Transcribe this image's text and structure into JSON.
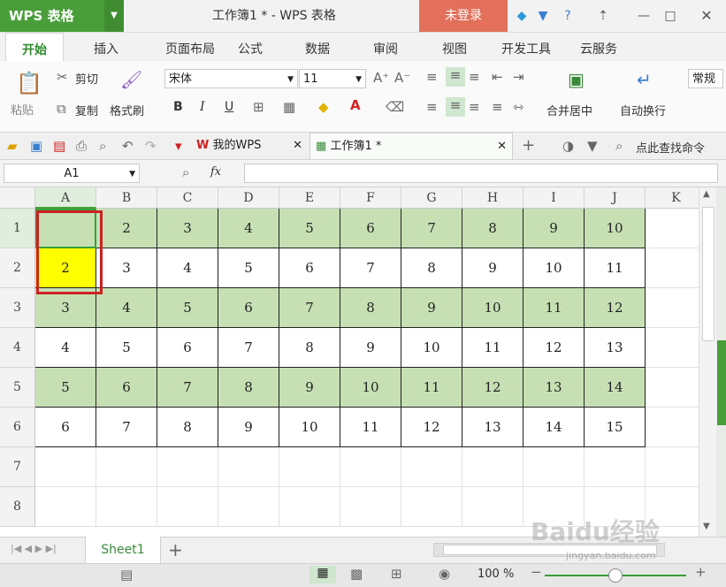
{
  "titlebar": {
    "app_name": "WPS 表格",
    "doc_title": "工作簿1 * - WPS 表格",
    "login": "未登录"
  },
  "menu": [
    "开始",
    "插入",
    "页面布局",
    "公式",
    "数据",
    "审阅",
    "视图",
    "开发工具",
    "云服务"
  ],
  "ribbon": {
    "paste": "粘贴",
    "cut": "剪切",
    "copy": "复制",
    "format_painter": "格式刷",
    "font_name": "宋体",
    "font_size": "11",
    "merge_center": "合并居中",
    "wrap_text": "自动换行",
    "number_format": "常规",
    "bold": "B",
    "italic": "I",
    "underline": "U"
  },
  "doc_tabs": {
    "mywps": "我的WPS",
    "workbook": "工作簿1 *",
    "search_command": "点此查找命令"
  },
  "formula_bar": {
    "cell_ref": "A1",
    "fx": "fx",
    "formula": ""
  },
  "grid": {
    "columns": [
      "A",
      "B",
      "C",
      "D",
      "E",
      "F",
      "G",
      "H",
      "I",
      "J",
      "K"
    ],
    "rows": [
      "1",
      "2",
      "3",
      "4",
      "5",
      "6",
      "7",
      "8"
    ],
    "cells": [
      [
        "",
        "2",
        "3",
        "4",
        "5",
        "6",
        "7",
        "8",
        "9",
        "10"
      ],
      [
        "2",
        "3",
        "4",
        "5",
        "6",
        "7",
        "8",
        "9",
        "10",
        "11"
      ],
      [
        "3",
        "4",
        "5",
        "6",
        "7",
        "8",
        "9",
        "10",
        "11",
        "12"
      ],
      [
        "4",
        "5",
        "6",
        "7",
        "8",
        "9",
        "10",
        "11",
        "12",
        "13"
      ],
      [
        "5",
        "6",
        "7",
        "8",
        "9",
        "10",
        "11",
        "12",
        "13",
        "14"
      ],
      [
        "6",
        "7",
        "8",
        "9",
        "10",
        "11",
        "12",
        "13",
        "14",
        "15"
      ]
    ],
    "shaded_rows": [
      1,
      3,
      5
    ],
    "shade_color": "#c6e0b4",
    "highlight_cell": "A2",
    "highlight_color": "#ffff00",
    "selection_outline_color": "#cc2222"
  },
  "sheets": [
    "Sheet1"
  ],
  "status": {
    "zoom": "100 %"
  },
  "watermark": {
    "brand": "Baidu经验",
    "url": "jingyan.baidu.com"
  },
  "colors": {
    "accent": "#4a9e3a",
    "login_bg": "#e2705a"
  }
}
